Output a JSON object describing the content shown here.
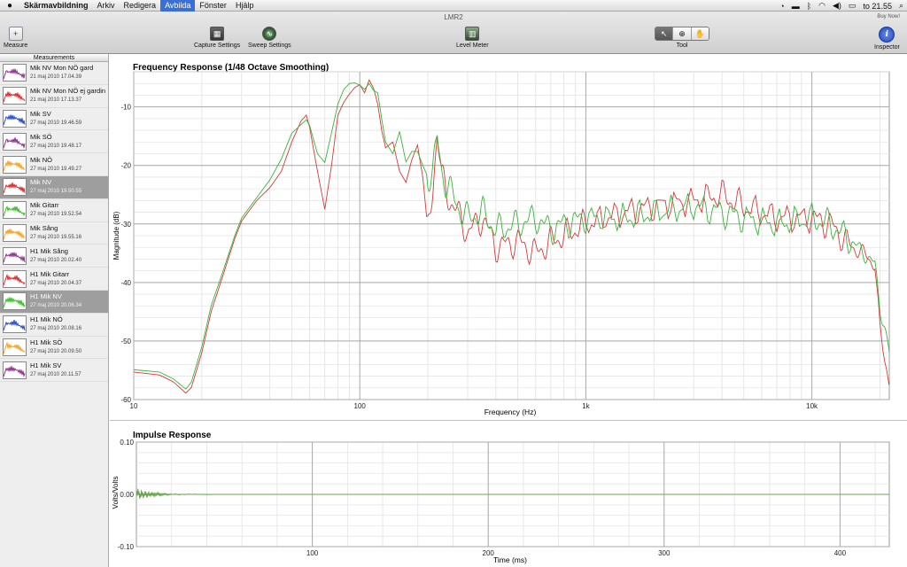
{
  "menubar": {
    "apple": "",
    "items": [
      "Skärmavbildning",
      "Arkiv",
      "Redigera",
      "Avbilda",
      "Fönster",
      "Hjälp"
    ],
    "clock": "to 21.55"
  },
  "window": {
    "title": "LMR2",
    "buy_now": "Buy Now!"
  },
  "toolbar": {
    "measure": "Measure",
    "capture_settings": "Capture Settings",
    "sweep_settings": "Sweep Settings",
    "level_meter": "Level Meter",
    "tool": "Tool",
    "inspector": "Inspector"
  },
  "sidebar": {
    "header": "Measurements",
    "items": [
      {
        "name": "Mik NV Mon NÖ gard",
        "date": "21 maj 2010 17.04.39",
        "color": "#8a2a8a",
        "selected": false
      },
      {
        "name": "Mik NV Mon NÖ ej gardin",
        "date": "21 maj 2010 17.13.37",
        "color": "#dd2222",
        "selected": false
      },
      {
        "name": "Mik SV",
        "date": "27 maj 2010 19.46.59",
        "color": "#2244cc",
        "selected": false
      },
      {
        "name": "Mik SÖ",
        "date": "27 maj 2010 19.48.17",
        "color": "#8a2a8a",
        "selected": false
      },
      {
        "name": "Mik NÖ",
        "date": "27 maj 2010 19.49.27",
        "color": "#f0a020",
        "selected": false
      },
      {
        "name": "Mik NV",
        "date": "27 maj 2010 19.50.55",
        "color": "#dd2222",
        "selected": true
      },
      {
        "name": "Mik Gitarr",
        "date": "27 maj 2010 19.52.54",
        "color": "#33bb22",
        "selected": false
      },
      {
        "name": "Mik Sång",
        "date": "27 maj 2010 19.55.16",
        "color": "#f0a020",
        "selected": false
      },
      {
        "name": "H1 Mik Sång",
        "date": "27 maj 2010 20.02.40",
        "color": "#8a2a8a",
        "selected": false
      },
      {
        "name": "H1 Mik Gitarr",
        "date": "27 maj 2010 20.04.37",
        "color": "#dd2222",
        "selected": false
      },
      {
        "name": "H1 Mik NV",
        "date": "27 maj 2010 20.06.34",
        "color": "#33bb22",
        "selected": true
      },
      {
        "name": "H1 Mik NÖ",
        "date": "27 maj 2010 20.08.16",
        "color": "#2244cc",
        "selected": false
      },
      {
        "name": "H1 Mik SÖ",
        "date": "27 maj 2010 20.09.50",
        "color": "#f0a020",
        "selected": false
      },
      {
        "name": "H1 Mik SV",
        "date": "27 maj 2010 20.11.57",
        "color": "#8a2a8a",
        "selected": false
      }
    ]
  },
  "chart_data": [
    {
      "type": "line",
      "title": "Frequency Response (1/48 Octave Smoothing)",
      "xlabel": "Frequency (Hz)",
      "ylabel": "Magnitude (dB)",
      "xscale": "log",
      "xlim": [
        10,
        22000
      ],
      "ylim": [
        -60,
        -4
      ],
      "xticks": [
        {
          "v": 10,
          "label": "10"
        },
        {
          "v": 100,
          "label": "100"
        },
        {
          "v": 1000,
          "label": "1k"
        },
        {
          "v": 10000,
          "label": "10k"
        }
      ],
      "yticks": [
        -60,
        -50,
        -40,
        -30,
        -20,
        -10
      ],
      "grid": true,
      "series": [
        {
          "color": "#d23a3a",
          "x": [
            10,
            13,
            15,
            17,
            18,
            20,
            22,
            25,
            28,
            30,
            35,
            40,
            45,
            50,
            55,
            58,
            60,
            65,
            70,
            75,
            80,
            85,
            90,
            95,
            100,
            105,
            110,
            115,
            120,
            125,
            130,
            140,
            150,
            160,
            170,
            180,
            190,
            200,
            210,
            220,
            230,
            240,
            250,
            270,
            300,
            350,
            400,
            500,
            600,
            700,
            800,
            1000,
            1500,
            2000,
            3000,
            4000,
            5000,
            7000,
            10000,
            12000,
            15000,
            17000,
            19000,
            20000,
            21000,
            22000
          ],
          "y": [
            -55.3,
            -55.8,
            -57,
            -58.9,
            -57.9,
            -52,
            -45,
            -38.4,
            -32.5,
            -29.5,
            -26,
            -23.8,
            -21,
            -16,
            -12.4,
            -11.4,
            -13.5,
            -21,
            -27.5,
            -20,
            -11.4,
            -9.2,
            -7.8,
            -6.7,
            -6.2,
            -7.6,
            -5.4,
            -6.8,
            -9.5,
            -14,
            -17,
            -16,
            -21,
            -22.9,
            -19,
            -16.5,
            -22,
            -31,
            -24,
            -14.3,
            -22,
            -24,
            -26,
            -28,
            -31.5,
            -29,
            -34,
            -33,
            -35,
            -33,
            -32,
            -30,
            -28,
            -27,
            -26,
            -25,
            -27,
            -29,
            -29,
            -30,
            -34,
            -35,
            -37,
            -48,
            -53,
            -57
          ]
        },
        {
          "color": "#3bb33b",
          "x": [
            10,
            13,
            15,
            17,
            18,
            20,
            22,
            25,
            28,
            30,
            35,
            40,
            45,
            50,
            55,
            58,
            60,
            65,
            70,
            75,
            80,
            85,
            90,
            95,
            100,
            105,
            110,
            115,
            120,
            125,
            130,
            140,
            150,
            160,
            170,
            180,
            190,
            200,
            210,
            220,
            230,
            240,
            250,
            270,
            300,
            350,
            400,
            500,
            600,
            700,
            800,
            1000,
            1500,
            2000,
            3000,
            4000,
            5000,
            7000,
            10000,
            12000,
            15000,
            17000,
            19000,
            20000,
            21000,
            22000
          ],
          "y": [
            -54.9,
            -55.3,
            -56.5,
            -58.2,
            -57,
            -51,
            -44,
            -37.7,
            -32,
            -29,
            -25.5,
            -22.5,
            -18.9,
            -14.5,
            -13,
            -12.2,
            -13.2,
            -18,
            -19.5,
            -14.4,
            -9.5,
            -7,
            -6,
            -5.9,
            -6.3,
            -7,
            -6,
            -7.2,
            -7.6,
            -12,
            -16,
            -18,
            -14.2,
            -19.4,
            -17.6,
            -17.6,
            -20,
            -22,
            -21,
            -15.5,
            -21,
            -23,
            -24,
            -27,
            -29,
            -28,
            -31,
            -30,
            -29,
            -31,
            -30,
            -29,
            -29,
            -28,
            -27,
            -28,
            -29,
            -30,
            -29,
            -30,
            -33,
            -35,
            -37,
            -44,
            -48,
            -52
          ]
        }
      ]
    },
    {
      "type": "line",
      "title": "Impulse Response",
      "xlabel": "Time (ms)",
      "ylabel": "Volts/Volts",
      "xlim": [
        0,
        428
      ],
      "ylim": [
        -0.1,
        0.1
      ],
      "xticks": [
        100,
        200,
        300,
        400
      ],
      "yticks": [
        {
          "v": 0.1,
          "label": "0.10"
        },
        {
          "v": 0,
          "label": "0.00"
        },
        {
          "v": -0.1,
          "label": "-0.10"
        }
      ],
      "grid": true,
      "series": [
        {
          "color": "#6aa84f",
          "x": [
            0,
            1,
            2,
            3,
            4,
            5,
            6,
            7,
            8,
            9,
            10,
            12,
            14,
            16,
            18,
            20,
            25,
            30,
            40,
            50,
            100,
            200,
            300,
            428
          ],
          "y": [
            0,
            0.006,
            -0.005,
            0.004,
            -0.004,
            0.003,
            -0.003,
            0.002,
            -0.002,
            0.002,
            -0.0015,
            0.0012,
            -0.001,
            0.0009,
            -0.0008,
            0.0006,
            -0.0004,
            0.0003,
            -0.0002,
            0.0001,
            0,
            0,
            0,
            0
          ]
        }
      ]
    }
  ]
}
